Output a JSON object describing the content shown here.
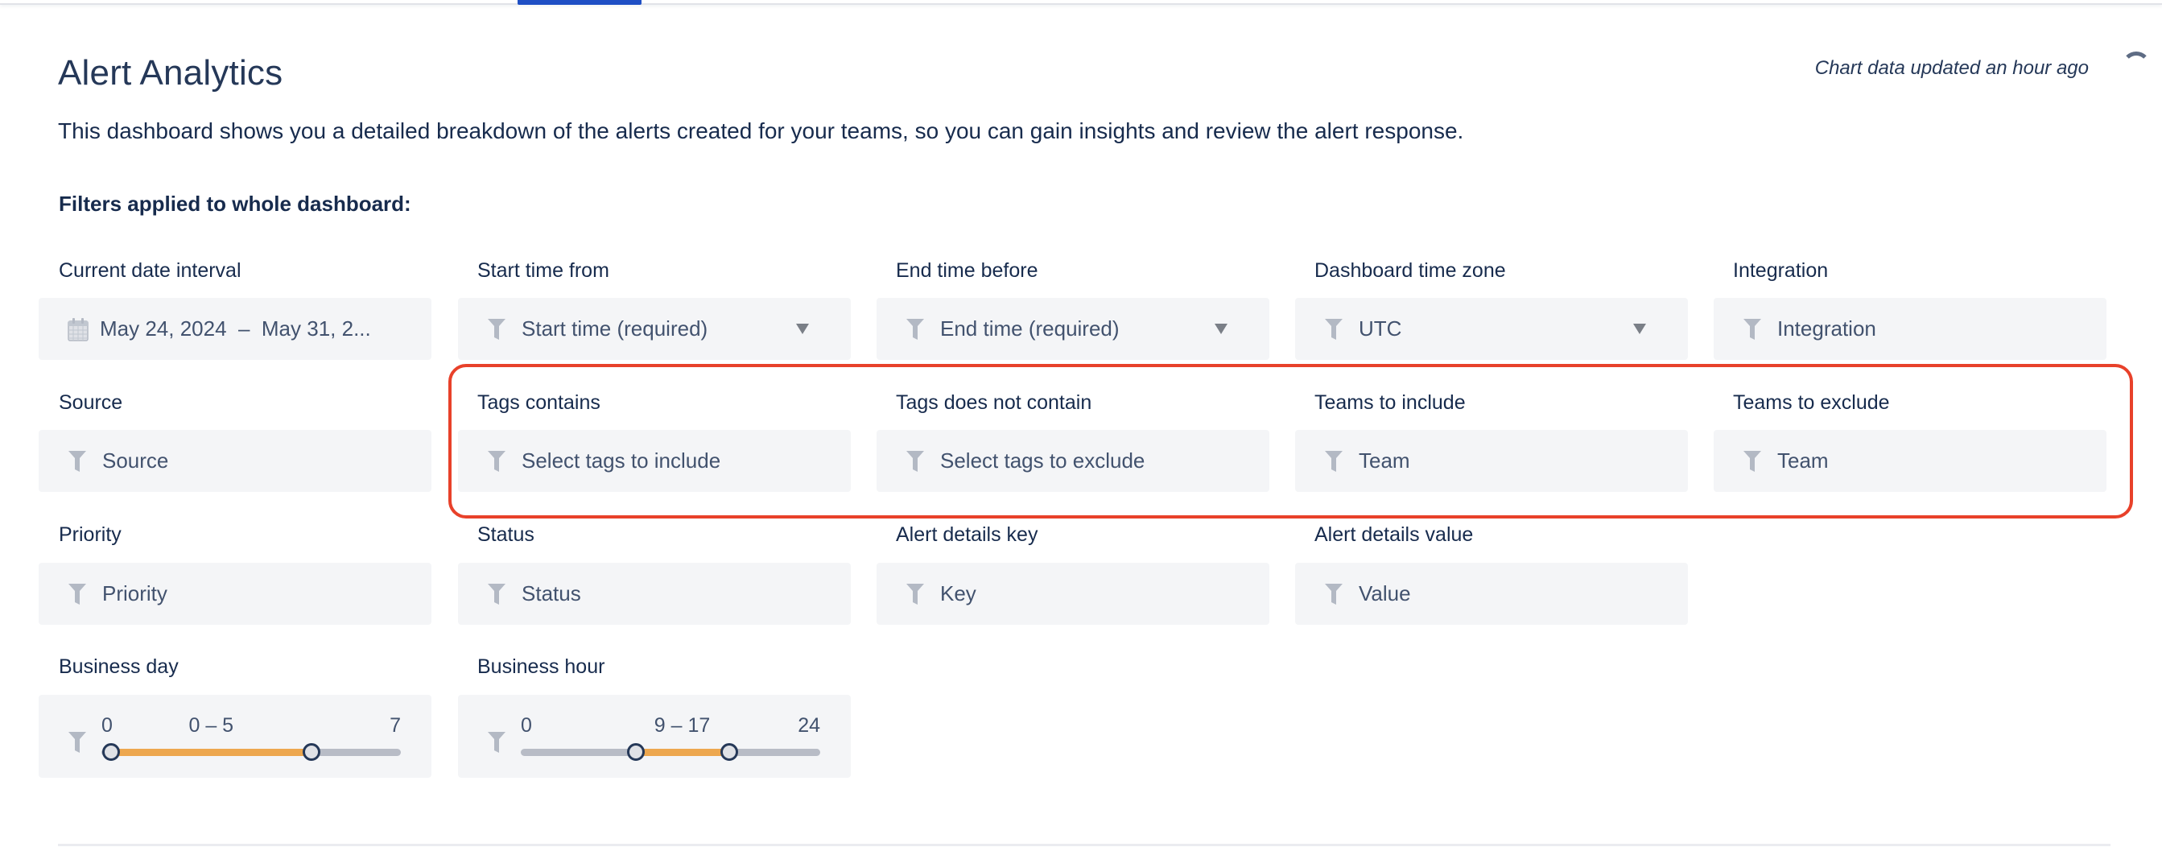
{
  "page": {
    "title": "Alert Analytics",
    "updated_text": "Chart data updated an hour ago",
    "description": "This dashboard shows you a detailed breakdown of the alerts created for your teams, so you can gain insights and review the alert response.",
    "filters_heading": "Filters applied to whole dashboard:"
  },
  "colors": {
    "accent": "#1f4fc4",
    "highlight": "#e8412a",
    "slider_fill": "#eda74f",
    "field_bg": "#f4f5f7"
  },
  "filters": {
    "date_interval": {
      "label": "Current date interval",
      "value": "May 24, 2024  –  May 31, 2...",
      "icon": "calendar-icon"
    },
    "start_time": {
      "label": "Start time from",
      "value": "Start time (required)",
      "icon": "filter-icon",
      "dropdown": true
    },
    "end_time": {
      "label": "End time before",
      "value": "End time (required)",
      "icon": "filter-icon",
      "dropdown": true
    },
    "time_zone": {
      "label": "Dashboard time zone",
      "value": "UTC",
      "icon": "filter-icon",
      "dropdown": true
    },
    "integration": {
      "label": "Integration",
      "value": "Integration",
      "icon": "filter-icon"
    },
    "source": {
      "label": "Source",
      "value": "Source",
      "icon": "filter-icon"
    },
    "tags_contains": {
      "label": "Tags contains",
      "value": "Select tags to include",
      "icon": "filter-icon"
    },
    "tags_not_contain": {
      "label": "Tags does not contain",
      "value": "Select tags to exclude",
      "icon": "filter-icon"
    },
    "teams_include": {
      "label": "Teams to include",
      "value": "Team",
      "icon": "filter-icon"
    },
    "teams_exclude": {
      "label": "Teams to exclude",
      "value": "Team",
      "icon": "filter-icon"
    },
    "priority": {
      "label": "Priority",
      "value": "Priority",
      "icon": "filter-icon"
    },
    "status": {
      "label": "Status",
      "value": "Status",
      "icon": "filter-icon"
    },
    "details_key": {
      "label": "Alert details key",
      "value": "Key",
      "icon": "filter-icon"
    },
    "details_value": {
      "label": "Alert details value",
      "value": "Value",
      "icon": "filter-icon"
    },
    "business_day": {
      "label": "Business day",
      "min": 0,
      "max": 7,
      "low": 0,
      "high": 5,
      "min_label": "0",
      "max_label": "7",
      "range_label": "0 – 5"
    },
    "business_hour": {
      "label": "Business hour",
      "min": 0,
      "max": 24,
      "low": 9,
      "high": 17,
      "min_label": "0",
      "max_label": "24",
      "range_label": "9 – 17"
    }
  }
}
